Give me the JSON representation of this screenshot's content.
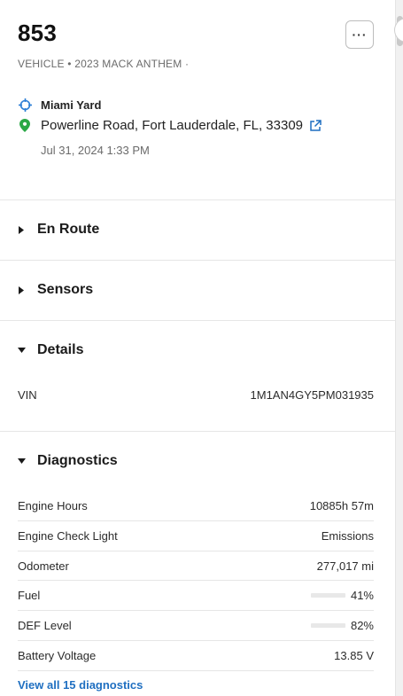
{
  "header": {
    "title": "853",
    "subtitle": "VEHICLE • 2023 MACK ANTHEM ·",
    "more_label": "···"
  },
  "location": {
    "name": "Miami Yard",
    "address": "Powerline Road, Fort Lauderdale, FL, 33309",
    "timestamp": "Jul 31, 2024 1:33 PM"
  },
  "sections": {
    "en_route": "En Route",
    "sensors": "Sensors",
    "details": "Details",
    "diagnostics": "Diagnostics"
  },
  "details": {
    "vin_label": "VIN",
    "vin_value": "1M1AN4GY5PM031935"
  },
  "diagnostics": {
    "rows": [
      {
        "label": "Engine Hours",
        "value": "10885h 57m"
      },
      {
        "label": "Engine Check Light",
        "value": "Emissions"
      },
      {
        "label": "Odometer",
        "value": "277,017 mi"
      },
      {
        "label": "Fuel",
        "value": "41%",
        "level": 0.41
      },
      {
        "label": "DEF Level",
        "value": "82%",
        "level": 0.82
      },
      {
        "label": "Battery Voltage",
        "value": "13.85 V"
      }
    ],
    "view_all": "View all 15 diagnostics"
  },
  "colors": {
    "accent": "#1f6fc1",
    "bar_fill": "#12a312",
    "location_pin": "#2aa846",
    "location_target": "#2d7fd6"
  },
  "icons": {
    "more": "more-icon",
    "target": "crosshair-icon",
    "pin": "map-pin-icon",
    "external": "external-link-icon",
    "caret_collapsed": "caret-right-icon",
    "caret_expanded": "caret-down-icon"
  }
}
